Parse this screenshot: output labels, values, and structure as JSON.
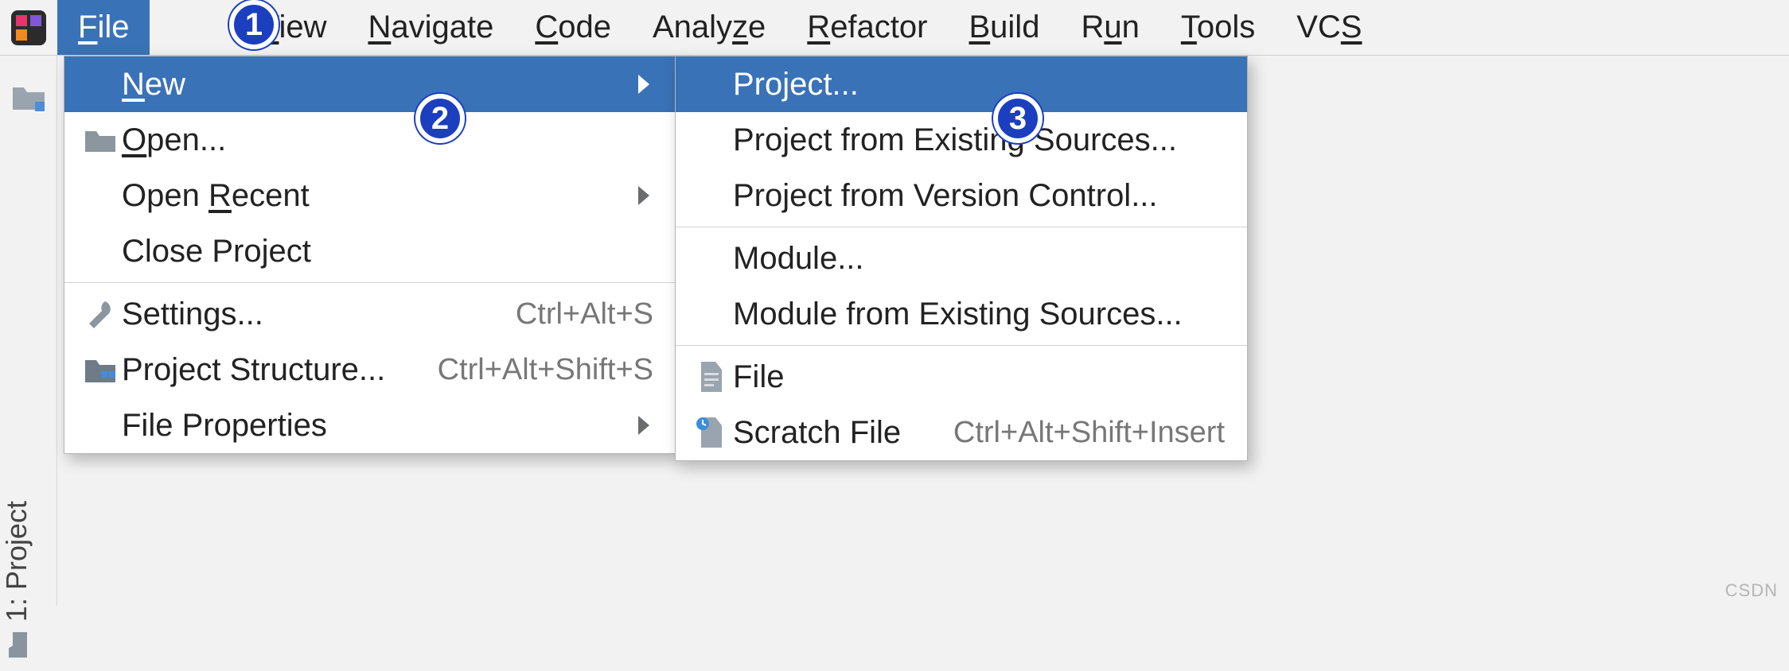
{
  "menubar": {
    "items": [
      {
        "label": "File",
        "mnemonic": "F",
        "selected": true
      },
      {
        "label": "",
        "mnemonic": "",
        "selected": false
      },
      {
        "label": "View",
        "mnemonic": "V",
        "selected": false
      },
      {
        "label": "Navigate",
        "mnemonic": "N",
        "selected": false
      },
      {
        "label": "Code",
        "mnemonic": "C",
        "selected": false
      },
      {
        "label": "Analyze",
        "mnemonic": "",
        "selected": false
      },
      {
        "label": "Refactor",
        "mnemonic": "R",
        "selected": false
      },
      {
        "label": "Build",
        "mnemonic": "B",
        "selected": false
      },
      {
        "label": "Run",
        "mnemonic": "u",
        "selected": false
      },
      {
        "label": "Tools",
        "mnemonic": "T",
        "selected": false
      },
      {
        "label": "VCS",
        "mnemonic": "S",
        "selected": false
      }
    ]
  },
  "sidebar": {
    "tool_label": "1: Project"
  },
  "file_menu": {
    "items": [
      {
        "icon": "",
        "label": "New",
        "mnemonic": "N",
        "shortcut": "",
        "submenu": true,
        "selected": true
      },
      {
        "icon": "folder",
        "label": "Open...",
        "mnemonic": "O",
        "shortcut": "",
        "submenu": false,
        "selected": false
      },
      {
        "icon": "",
        "label": "Open Recent",
        "mnemonic": "R",
        "shortcut": "",
        "submenu": true,
        "selected": false
      },
      {
        "icon": "",
        "label": "Close Project",
        "mnemonic": "",
        "shortcut": "",
        "submenu": false,
        "selected": false
      },
      {
        "sep": true
      },
      {
        "icon": "wrench",
        "label": "Settings...",
        "mnemonic": "",
        "shortcut": "Ctrl+Alt+S",
        "submenu": false,
        "selected": false
      },
      {
        "icon": "struct",
        "label": "Project Structure...",
        "mnemonic": "",
        "shortcut": "Ctrl+Alt+Shift+S",
        "submenu": false,
        "selected": false
      },
      {
        "icon": "",
        "label": "File Properties",
        "mnemonic": "",
        "shortcut": "",
        "submenu": true,
        "selected": false
      }
    ]
  },
  "new_menu": {
    "items": [
      {
        "icon": "",
        "label": "Project...",
        "shortcut": "",
        "selected": true
      },
      {
        "icon": "",
        "label": "Project from Existing Sources...",
        "shortcut": "",
        "selected": false
      },
      {
        "icon": "",
        "label": "Project from Version Control...",
        "shortcut": "",
        "selected": false
      },
      {
        "sep": true
      },
      {
        "icon": "",
        "label": "Module...",
        "shortcut": "",
        "selected": false
      },
      {
        "icon": "",
        "label": "Module from Existing Sources...",
        "shortcut": "",
        "selected": false
      },
      {
        "sep": true
      },
      {
        "icon": "file",
        "label": "File",
        "shortcut": "",
        "selected": false
      },
      {
        "icon": "scratch",
        "label": "Scratch File",
        "shortcut": "Ctrl+Alt+Shift+Insert",
        "selected": false
      }
    ]
  },
  "badges": {
    "1": "1",
    "2": "2",
    "3": "3"
  },
  "watermark": "CSDN"
}
